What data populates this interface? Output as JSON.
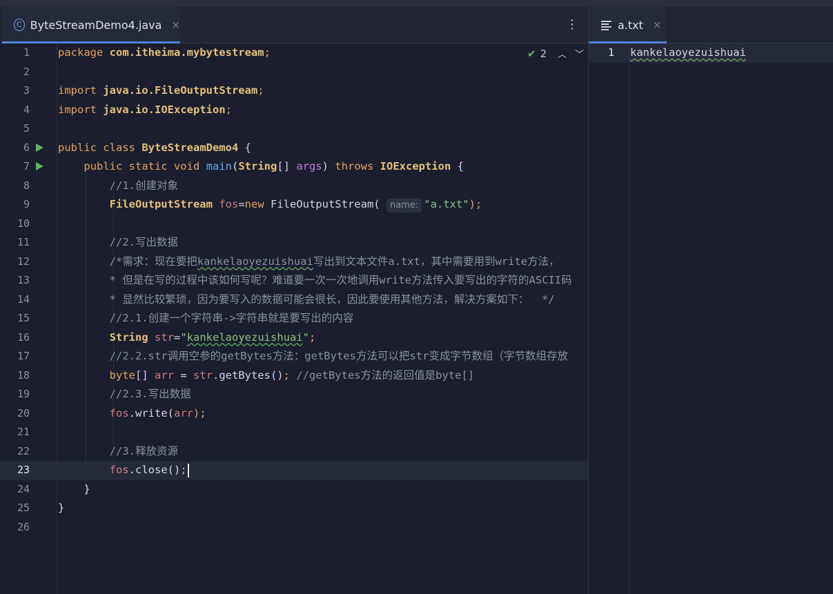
{
  "editor_left": {
    "tab": {
      "icon": "class-icon",
      "label": "ByteStreamDemo4.java",
      "close": "×"
    },
    "inspection": {
      "icon": "check-icon",
      "count": "2"
    },
    "line_numbers": [
      "1",
      "2",
      "3",
      "4",
      "5",
      "6",
      "7",
      "8",
      "9",
      "10",
      "11",
      "12",
      "13",
      "14",
      "15",
      "16",
      "17",
      "18",
      "19",
      "20",
      "21",
      "22",
      "23",
      "24",
      "25",
      "26"
    ],
    "code": {
      "l1_kw": "package",
      "l1_pkg": "com.itheima.mybytestream",
      "l1_semi": ";",
      "l3_kw": "import",
      "l3_path": "java.io.FileOutputStream",
      "l3_semi": ";",
      "l4_kw": "import",
      "l4_path": "java.io.IOException",
      "l4_semi": ";",
      "l6_kw": "public class",
      "l6_name": "ByteStreamDemo4",
      "l6_rest": " {",
      "l7_kw": "public static void",
      "l7_fn": "main",
      "l7_p1": "(",
      "l7_type": "String",
      "l7_p2": "[] ",
      "l7_arg": "args",
      "l7_p3": ") ",
      "l7_kw2": "throws",
      "l7_exc": "IOException",
      "l7_rest": " {",
      "l8": "//1.创建对象",
      "l9_type": "FileOutputStream",
      "l9_var": "fos",
      "l9_eq": "=",
      "l9_new": "new",
      "l9_call": " FileOutputStream(",
      "l9_hint": "name:",
      "l9_str": "\"a.txt\"",
      "l9_end": ");",
      "l11": "//2.写出数据",
      "l12_a": "/*需求：现在要把",
      "l12_b": "kankelaoyezuishuai",
      "l12_c": "写出到文本文件a.txt，其中需要用到write方法，",
      "l13": "* 但是在写的过程中该如何写呢？难道要一次一次地调用write方法传入要写出的字符的ASCII码",
      "l14": "* 显然比较繁琐，因为要写入的数据可能会很长，因此要使用其他方法，解决方案如下：  */",
      "l15": "//2.1.创建一个字符串->字符串就是要写出的内容",
      "l16_type": "String",
      "l16_var": "str",
      "l16_eq": "=",
      "l16_q1": "\"",
      "l16_str": "kankelaoyezuishuai",
      "l16_q2": "\"",
      "l16_end": ";",
      "l17": "//2.2.str调用空参的getBytes方法：getBytes方法可以把str变成字节数组（字节数组存放",
      "l18_kw": "byte",
      "l18_p": "[] ",
      "l18_var": "arr",
      "l18_eq": " = ",
      "l18_obj": "str",
      "l18_call": ".getBytes()",
      "l18_semi": ";",
      "l18_c": " //getBytes方法的返回值是byte[]",
      "l19": "//2.3.写出数据",
      "l20_obj": "fos",
      "l20_call": ".write(",
      "l20_arg": "arr",
      "l20_end": ");",
      "l22": "//3.释放资源",
      "l23_obj": "fos",
      "l23_call": ".close()",
      "l23_end": ";",
      "l24": "}",
      "l25": "}"
    }
  },
  "editor_right": {
    "tab": {
      "icon": "text-file-icon",
      "label": "a.txt",
      "close": "×"
    },
    "line_numbers": [
      "1"
    ],
    "content": "kankelaoyezuishuai"
  },
  "more_menu": "⋮"
}
